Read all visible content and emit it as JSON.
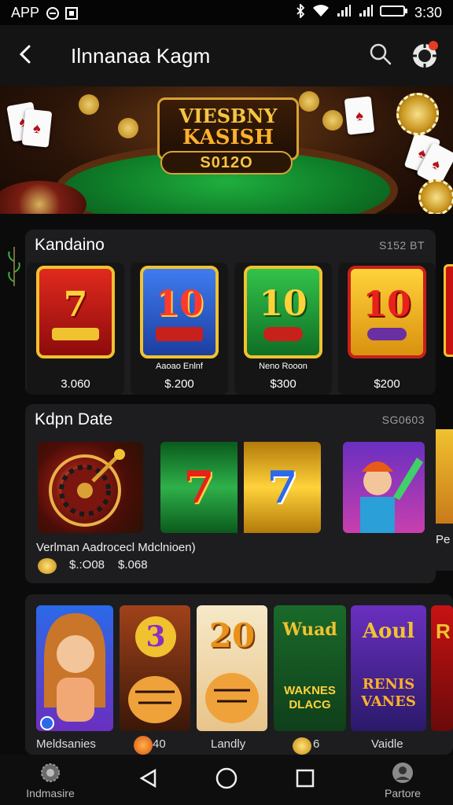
{
  "status": {
    "left_text": "APP",
    "time": "3:30"
  },
  "header": {
    "title": "Ilnnanaa Kagm"
  },
  "hero": {
    "logo_line1": "VIESBNY",
    "logo_line2": "KASISH",
    "amount": "S012O"
  },
  "section1": {
    "title": "Kandaino",
    "meta": "S152 BT",
    "items": [
      {
        "num": "7",
        "sub": "",
        "price": "3.060",
        "color": "#c81212"
      },
      {
        "num": "10",
        "sub": "Aaoao Enlnf",
        "price": "$.200",
        "color": "#2a5fd8"
      },
      {
        "num": "10",
        "sub": "Neno Rooon",
        "price": "$300",
        "color": "#19a33a"
      },
      {
        "num": "10",
        "sub": "",
        "price": "$200",
        "color": "#f2b51a"
      }
    ]
  },
  "section2": {
    "title": "Kdpn Date",
    "meta": "SG0603",
    "game_label": "Verlman Aadrocecl Mdclnioen)",
    "price_a": "$.:O08",
    "price_b": "$.068",
    "badge": "Pe"
  },
  "section3": {
    "labels": [
      "Meldsanies",
      "40",
      "Landly",
      "6",
      "Vaidle"
    ],
    "tiles": [
      "3",
      "20",
      "Wuad",
      "Aoul",
      "R"
    ],
    "tile_texts": [
      "",
      "",
      "WAKNES DLACG",
      "RENIS VANES",
      ""
    ]
  },
  "nav": {
    "left_label": "Indmasire",
    "right_label": "Partore"
  },
  "colors": {
    "bg": "#0b0b0c",
    "panel": "#1d1d1f",
    "header": "#141414",
    "accent": "#d9a233"
  }
}
